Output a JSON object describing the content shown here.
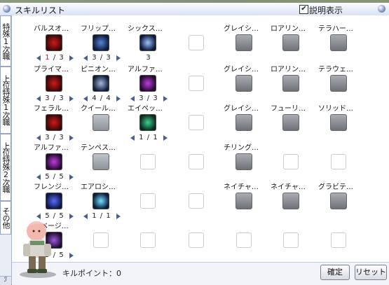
{
  "window": {
    "title": "スキルリスト",
    "show_desc_label": "説明表示",
    "show_desc_checked": true
  },
  "tabs": [
    {
      "label": "特殊1次職"
    },
    {
      "label": "上位特殊1次職"
    },
    {
      "label": "上位特殊2次職"
    },
    {
      "label": "その他"
    }
  ],
  "skills_left": [
    {
      "name": "バルスオ…",
      "level": "1 / 3",
      "cur_red": true,
      "state": "active",
      "icon": "red-flame-icon"
    },
    {
      "name": "フリップ…",
      "level": "3 / 3",
      "state": "active",
      "icon": "blue-slash-icon"
    },
    {
      "name": "シックス…",
      "level": "3",
      "state": "active",
      "no_arrows": true,
      "icon": "eye-orb-icon"
    },
    {
      "name": "プライマ…",
      "level": "3 / 3",
      "state": "active",
      "icon": "red-flame-icon"
    },
    {
      "name": "ピニオン…",
      "level": "4 / 4",
      "state": "active",
      "icon": "wind-lines-icon"
    },
    {
      "name": "アルファ…",
      "level": "3 / 3",
      "state": "active",
      "icon": "purple-claw-icon"
    },
    {
      "name": "フェラル…",
      "level": "3 / 3",
      "state": "active",
      "icon": "red-flame-icon"
    },
    {
      "name": "クイール…",
      "level": "",
      "state": "locked",
      "icon": "feather-icon"
    },
    {
      "name": "エイペッ…",
      "level": "1 / 1",
      "state": "active",
      "icon": "green-beast-icon"
    },
    {
      "name": "アルファ…",
      "level": "5 / 5",
      "state": "active",
      "icon": "purple-claw-icon"
    },
    {
      "name": "テンペス…",
      "level": "",
      "state": "locked",
      "icon": "tempest-icon"
    },
    {
      "name": "フレンジ…",
      "level": "5 / 5",
      "state": "active",
      "icon": "blue-beast-icon"
    },
    {
      "name": "エアロシ…",
      "level": "1 / 1",
      "state": "active",
      "icon": "aero-icon"
    },
    {
      "name": "サベージ…",
      "level": "5 / 5",
      "state": "active",
      "icon": "purple-fang-icon"
    }
  ],
  "skills_right": [
    {
      "name": "グレイシ…",
      "icon": "shield-icon"
    },
    {
      "name": "ロアリン…",
      "icon": "roar-icon"
    },
    {
      "name": "テラハー…",
      "icon": "terra-icon"
    },
    {
      "name": "グレイシ…",
      "icon": "shield-slash-icon"
    },
    {
      "name": "ロアリン…",
      "icon": "arrow-icon"
    },
    {
      "name": "テラウェ…",
      "icon": "wave-icon"
    },
    {
      "name": "グレイシ…",
      "icon": "figure-icon"
    },
    {
      "name": "フューリ…",
      "icon": "fury-icon"
    },
    {
      "name": "ソリッド…",
      "icon": "solid-icon"
    },
    {
      "name": "チリング…",
      "icon": "chill-icon"
    },
    {
      "name": "ネイチャ…",
      "icon": "nature-icon"
    },
    {
      "name": "ネイチャ…",
      "icon": "nature-sparkle-icon"
    },
    {
      "name": "グラビテ…",
      "icon": "gravity-icon"
    }
  ],
  "footer": {
    "skill_points": "キルポイント：0",
    "confirm_label": "確定",
    "reset_label": "リセット"
  },
  "colors": {
    "title_bg": "#e3e9f6",
    "level_arrow": "#4c5f8f",
    "level_red": "#c8102e"
  }
}
